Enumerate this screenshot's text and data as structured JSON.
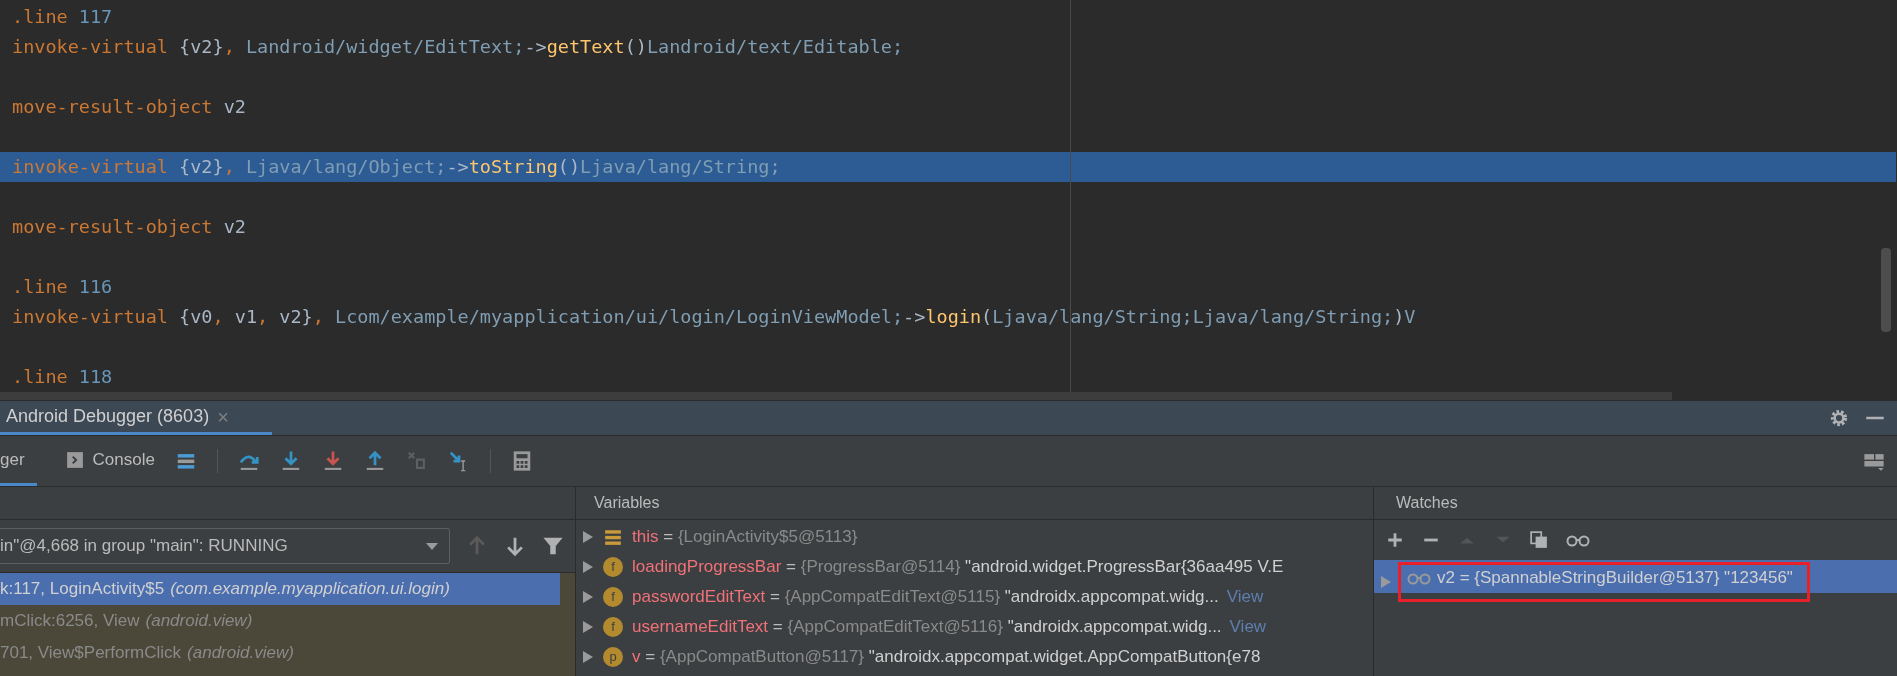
{
  "editor": {
    "blocks": [
      {
        "lines": [
          {
            "selected": false,
            "tokens": [
              {
                "kind": "keyword",
                "text": ".line "
              },
              {
                "kind": "number",
                "text": "117"
              }
            ]
          },
          {
            "selected": false,
            "tokens": [
              {
                "kind": "keyword",
                "text": "invoke-virtual "
              },
              {
                "kind": "plain",
                "text": "{v2}"
              },
              {
                "kind": "keyword",
                "text": ", "
              },
              {
                "kind": "type",
                "text": "Landroid/widget/EditText;"
              },
              {
                "kind": "plain",
                "text": "->"
              },
              {
                "kind": "method",
                "text": "getText"
              },
              {
                "kind": "plain",
                "text": "()"
              },
              {
                "kind": "type",
                "text": "Landroid/text/Editable;"
              }
            ]
          }
        ]
      },
      {
        "lines": [
          {
            "selected": false,
            "tokens": [
              {
                "kind": "keyword",
                "text": "move-result-object "
              },
              {
                "kind": "plain",
                "text": "v2"
              }
            ]
          }
        ]
      },
      {
        "lines": [
          {
            "selected": true,
            "tokens": [
              {
                "kind": "keyword",
                "text": "invoke-virtual "
              },
              {
                "kind": "plain",
                "text": "{v2}"
              },
              {
                "kind": "keyword",
                "text": ", "
              },
              {
                "kind": "type",
                "text": "Ljava/lang/Object;"
              },
              {
                "kind": "plain",
                "text": "->"
              },
              {
                "kind": "method",
                "text": "toString"
              },
              {
                "kind": "plain",
                "text": "()"
              },
              {
                "kind": "type",
                "text": "Ljava/lang/String;"
              }
            ]
          }
        ]
      },
      {
        "lines": [
          {
            "selected": false,
            "tokens": [
              {
                "kind": "keyword",
                "text": "move-result-object "
              },
              {
                "kind": "plain",
                "text": "v2"
              }
            ]
          }
        ]
      },
      {
        "lines": [
          {
            "selected": false,
            "tokens": [
              {
                "kind": "keyword",
                "text": ".line "
              },
              {
                "kind": "number",
                "text": "116"
              }
            ]
          },
          {
            "selected": false,
            "tokens": [
              {
                "kind": "keyword",
                "text": "invoke-virtual "
              },
              {
                "kind": "plain",
                "text": "{v0"
              },
              {
                "kind": "keyword",
                "text": ", "
              },
              {
                "kind": "plain",
                "text": "v1"
              },
              {
                "kind": "keyword",
                "text": ", "
              },
              {
                "kind": "plain",
                "text": "v2}"
              },
              {
                "kind": "keyword",
                "text": ", "
              },
              {
                "kind": "type",
                "text": "Lcom/example/myapplication/ui/login/LoginViewModel;"
              },
              {
                "kind": "plain",
                "text": "->"
              },
              {
                "kind": "method",
                "text": "login"
              },
              {
                "kind": "plain",
                "text": "("
              },
              {
                "kind": "type",
                "text": "Ljava/lang/String;Ljava/lang/String;"
              },
              {
                "kind": "plain",
                "text": ")"
              },
              {
                "kind": "type",
                "text": "V"
              }
            ]
          }
        ]
      },
      {
        "lines": [
          {
            "selected": false,
            "tokens": [
              {
                "kind": "keyword",
                "text": ".line "
              },
              {
                "kind": "number",
                "text": "118"
              }
            ]
          }
        ]
      }
    ]
  },
  "debug_tab": {
    "title": "Android Debugger (8603)",
    "close": "×"
  },
  "subtabs": [
    {
      "label": "ger",
      "selected": true
    },
    {
      "label": "Console",
      "selected": false
    }
  ],
  "frames": {
    "thread": "in\"@4,668 in group \"main\": RUNNING",
    "rows": [
      {
        "selected": true,
        "library": false,
        "method": "k:117, LoginActivity$5",
        "package": "(com.example.myapplication.ui.login)"
      },
      {
        "selected": false,
        "library": true,
        "method": "mClick:6256, View",
        "package": "(android.view)"
      },
      {
        "selected": false,
        "library": true,
        "method": "701, View$PerformClick",
        "package": "(android.view)"
      }
    ]
  },
  "variables": {
    "title": "Variables",
    "rows": [
      {
        "kind": "object",
        "name": "this",
        "sep": "=",
        "value": "{LoginActivity$5@5113}"
      },
      {
        "kind": "field",
        "badge": "f",
        "name": "loadingProgressBar",
        "sep": "=",
        "value": "{ProgressBar@5114}",
        "detail": "\"android.widget.ProgressBar{36aa495 V.E"
      },
      {
        "kind": "field",
        "badge": "f",
        "name": "passwordEditText",
        "sep": "=",
        "value": "{AppCompatEditText@5115}",
        "detail": "\"androidx.appcompat.widg...",
        "link": "View"
      },
      {
        "kind": "field",
        "badge": "f",
        "name": "usernameEditText",
        "sep": "=",
        "value": "{AppCompatEditText@5116}",
        "detail": "\"androidx.appcompat.widg...",
        "link": "View"
      },
      {
        "kind": "param",
        "badge": "p",
        "name": "v",
        "sep": "=",
        "value": "{AppCompatButton@5117}",
        "detail": "\"androidx.appcompat.widget.AppCompatButton{e78"
      }
    ]
  },
  "watches": {
    "title": "Watches",
    "rows": [
      {
        "selected": true,
        "annotated": true,
        "text": "v2 = {SpannableStringBuilder@5137} \"123456\""
      }
    ]
  }
}
